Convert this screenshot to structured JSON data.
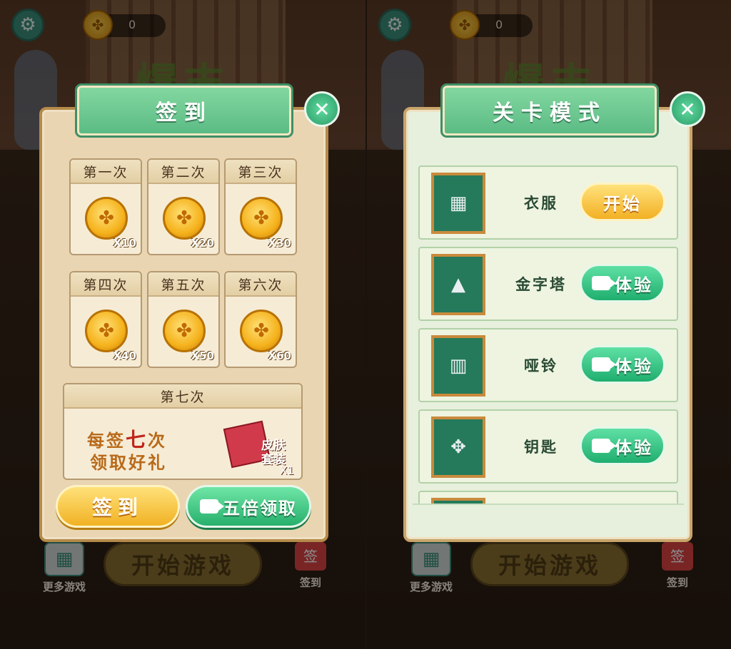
{
  "hud": {
    "coins": "0",
    "settings_icon": "gear-icon",
    "coin_icon": "coin-icon"
  },
  "home": {
    "start_label": "开始游戏",
    "more_label": "更多游戏",
    "sign_label": "签到",
    "logo_text": "爆丰"
  },
  "signin": {
    "title": "签到",
    "days": [
      {
        "label": "第一次",
        "reward": "X10"
      },
      {
        "label": "第二次",
        "reward": "X20"
      },
      {
        "label": "第三次",
        "reward": "X30"
      },
      {
        "label": "第四次",
        "reward": "X40"
      },
      {
        "label": "第五次",
        "reward": "X50"
      },
      {
        "label": "第六次",
        "reward": "X60"
      }
    ],
    "day7": {
      "label": "第七次",
      "line1_a": "每签",
      "line1_b": "七",
      "line1_c": "次",
      "line2": "领取好礼",
      "gift_name": "皮肤套装",
      "gift_qty": "X1"
    },
    "sign_button": "签到",
    "five_button": "五倍领取"
  },
  "levels": {
    "title": "关卡模式",
    "items": [
      {
        "name": "衣服",
        "action": "开始",
        "type": "start"
      },
      {
        "name": "金字塔",
        "action": "体验",
        "type": "trial"
      },
      {
        "name": "哑铃",
        "action": "体验",
        "type": "trial"
      },
      {
        "name": "钥匙",
        "action": "体验",
        "type": "trial"
      }
    ]
  },
  "colors": {
    "accent_green": "#27b06c",
    "accent_gold": "#f1b224",
    "panel_tan": "#e9d5b1"
  }
}
